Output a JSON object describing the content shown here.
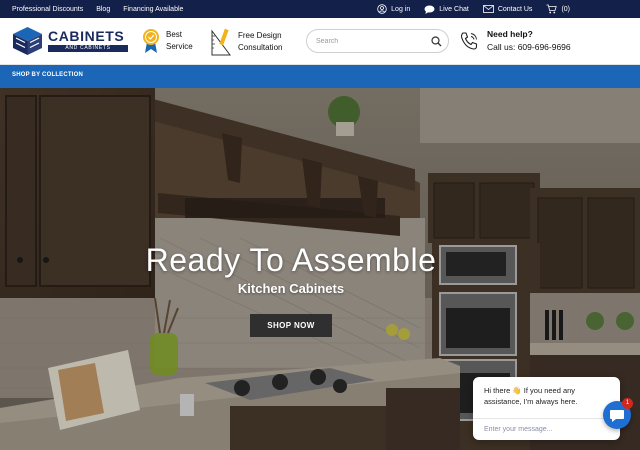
{
  "topbar": {
    "links": [
      "Professional Discounts",
      "Blog",
      "Financing Available"
    ],
    "login": "Log in",
    "live_chat": "Live Chat",
    "contact": "Contact Us",
    "cart_count": "(0)"
  },
  "header": {
    "logo_word": "CABINETS",
    "logo_band": "AND CABINETS",
    "feature_service": {
      "line1": "Best",
      "line2": "Service"
    },
    "feature_design": {
      "line1": "Free Design",
      "line2": "Consultation"
    },
    "search_placeholder": "Search",
    "help_title": "Need help?",
    "help_phone": "Call us: 609-696-9696"
  },
  "nav": {
    "label": "SHOP BY COLLECTION"
  },
  "hero": {
    "title": "Ready To Assemble",
    "subtitle": "Kitchen Cabinets",
    "cta": "SHOP NOW"
  },
  "chat": {
    "greeting": "Hi there 👋 If you need any assistance, I'm always here.",
    "placeholder": "Enter your message...",
    "badge": "1"
  },
  "colors": {
    "topbar": "#13204a",
    "nav": "#1b66b7",
    "brand": "#1a2a5c",
    "chat_button": "#1e6fd1"
  }
}
